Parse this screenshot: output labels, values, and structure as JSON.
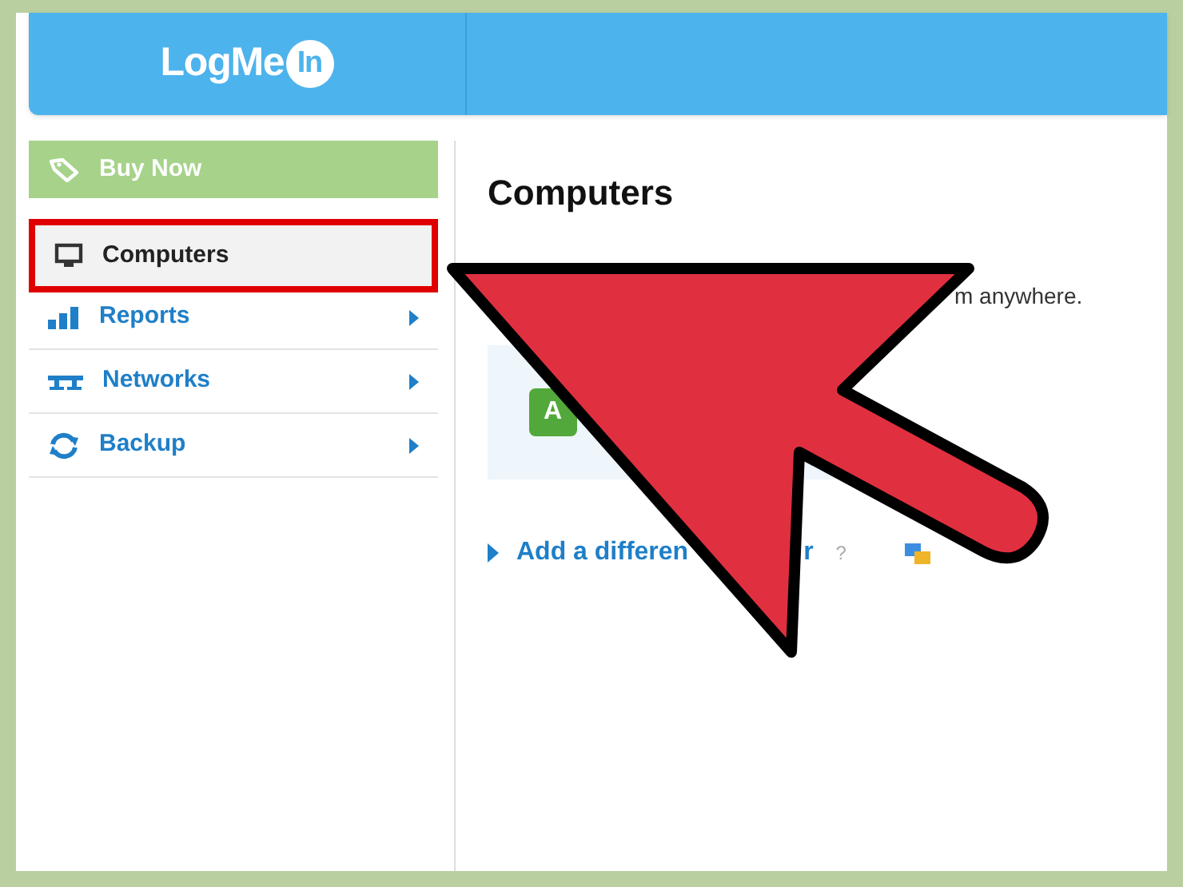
{
  "header": {
    "logo": {
      "text": "LogMe",
      "badge": "In"
    }
  },
  "sidebar": {
    "items": [
      {
        "kind": "promo",
        "label": "Buy Now"
      },
      {
        "kind": "nav",
        "label": "Computers",
        "selected": true,
        "highlighted": true,
        "has_submenu": false
      },
      {
        "kind": "nav",
        "label": "Reports",
        "selected": false,
        "highlighted": false,
        "has_submenu": true
      },
      {
        "kind": "nav",
        "label": "Networks",
        "selected": false,
        "highlighted": false,
        "has_submenu": true
      },
      {
        "kind": "nav",
        "label": "Backup",
        "selected": false,
        "highlighted": false,
        "has_submenu": true
      }
    ]
  },
  "content": {
    "title": "Computers",
    "intro_fragment": "m anywhere.",
    "add_button_fragment": "A",
    "link": {
      "start": "Add a differen",
      "end": "r",
      "help": "?"
    }
  }
}
